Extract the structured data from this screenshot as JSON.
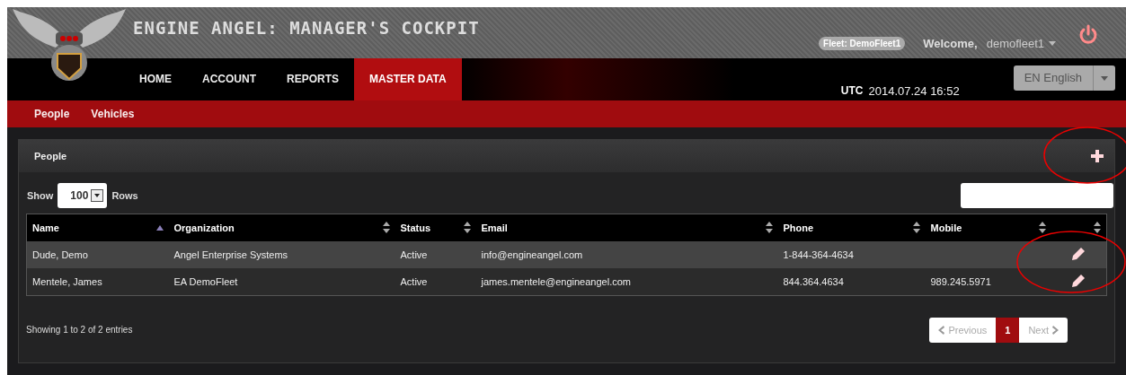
{
  "header": {
    "title": "ENGINE ANGEL: MANAGER'S COCKPIT",
    "fleet_badge": "Fleet: DemoFleet1",
    "welcome_label": "Welcome,",
    "user": "demofleet1"
  },
  "nav": [
    {
      "label": "HOME",
      "selected": false
    },
    {
      "label": "ACCOUNT",
      "selected": false
    },
    {
      "label": "REPORTS",
      "selected": false
    },
    {
      "label": "MASTER DATA",
      "selected": true
    }
  ],
  "clock": {
    "label": "UTC",
    "value": "2014.07.24 16:52"
  },
  "language": {
    "value": "EN English"
  },
  "subnav": [
    {
      "label": "People"
    },
    {
      "label": "Vehicles"
    }
  ],
  "panel": {
    "title": "People",
    "length": {
      "before": "Show",
      "value": "100",
      "after": "Rows"
    },
    "table": {
      "columns": [
        {
          "label": "Name",
          "sorted_ascending": true
        },
        {
          "label": "Organization",
          "sorted_ascending": false
        },
        {
          "label": "Status",
          "sorted_ascending": false
        },
        {
          "label": "Email",
          "sorted_ascending": false
        },
        {
          "label": "Phone",
          "sorted_ascending": false
        },
        {
          "label": "Mobile",
          "sorted_ascending": false
        },
        {
          "sorted_ascending": false
        }
      ],
      "rows": [
        {
          "cells": [
            "Dude, Demo",
            "Angel Enterprise Systems",
            "Active",
            "info@engineangel.com",
            "1-844-364-4634",
            null
          ]
        },
        {
          "cells": [
            "Mentele, James",
            "EA DemoFleet",
            "Active",
            "james.mentele@engineangel.com",
            "844.364.4634",
            "989.245.5971"
          ]
        }
      ]
    },
    "info": "Showing 1 to 2 of 2 entries",
    "pagination": [
      {
        "label": "Previous",
        "kind": "prev",
        "disabled": true,
        "selected": false
      },
      {
        "label": "1",
        "kind": "page",
        "disabled": false,
        "selected": true
      },
      {
        "label": "Next",
        "kind": "next",
        "disabled": true,
        "selected": false
      }
    ]
  }
}
